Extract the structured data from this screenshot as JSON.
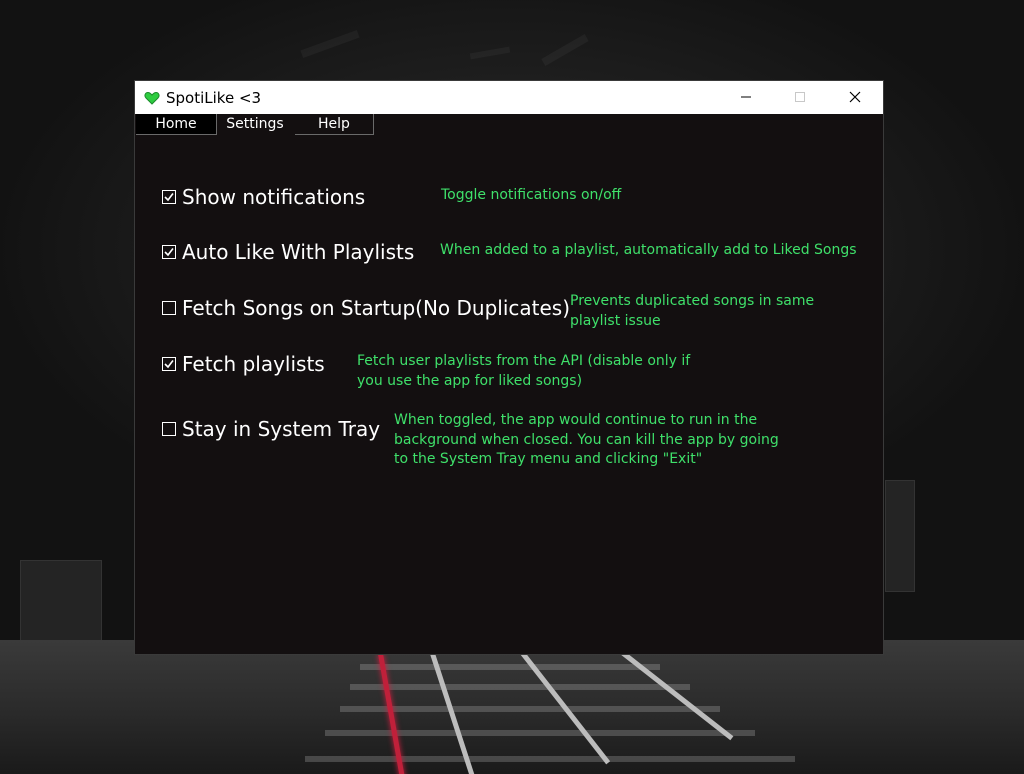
{
  "window": {
    "title": "SpotiLike <3",
    "icon": "green-heart-icon",
    "controls": [
      "minimize-icon",
      "maximize-icon",
      "close-icon"
    ]
  },
  "menu": {
    "tabs": [
      {
        "label": "Home",
        "selected": true
      },
      {
        "label": "Settings",
        "selected": false
      },
      {
        "label": "Help",
        "selected": false
      }
    ]
  },
  "settings": [
    {
      "label": "Show notifications",
      "checked": true,
      "description": "Toggle notifications on/off"
    },
    {
      "label": "Auto Like With Playlists",
      "checked": true,
      "description": "When added to a playlist, automatically add to Liked Songs"
    },
    {
      "label": "Fetch Songs on Startup(No Duplicates)",
      "checked": false,
      "description": "Prevents duplicated songs in same\nplaylist issue"
    },
    {
      "label": "Fetch playlists",
      "checked": true,
      "description": "Fetch user playlists from the API (disable only if\nyou use the app for liked songs)"
    },
    {
      "label": "Stay in System Tray",
      "checked": false,
      "description": "When toggled, the app would continue to run in the\nbackground when closed. You can kill the app by going\nto the System Tray menu and clicking \"Exit\""
    }
  ],
  "colors": {
    "window_bg": "#130f10",
    "description_text": "#3fe06a",
    "label_text": "#ffffff",
    "icon_green": "#2ecc40"
  }
}
